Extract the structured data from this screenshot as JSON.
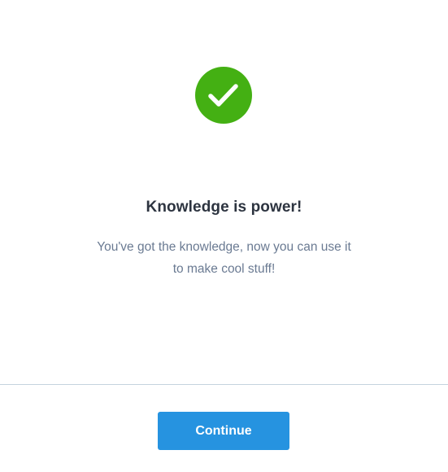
{
  "colors": {
    "success": "#44b013",
    "primary": "#2693e0",
    "heading": "#2d3440",
    "body": "#6a7a92",
    "divider": "#c5d3de"
  },
  "status_icon": "checkmark-icon",
  "title": "Knowledge is power!",
  "message": {
    "line1": "You've got the knowledge, now you can use it",
    "line2": "to make cool stuff!"
  },
  "footer": {
    "continue_label": "Continue"
  }
}
